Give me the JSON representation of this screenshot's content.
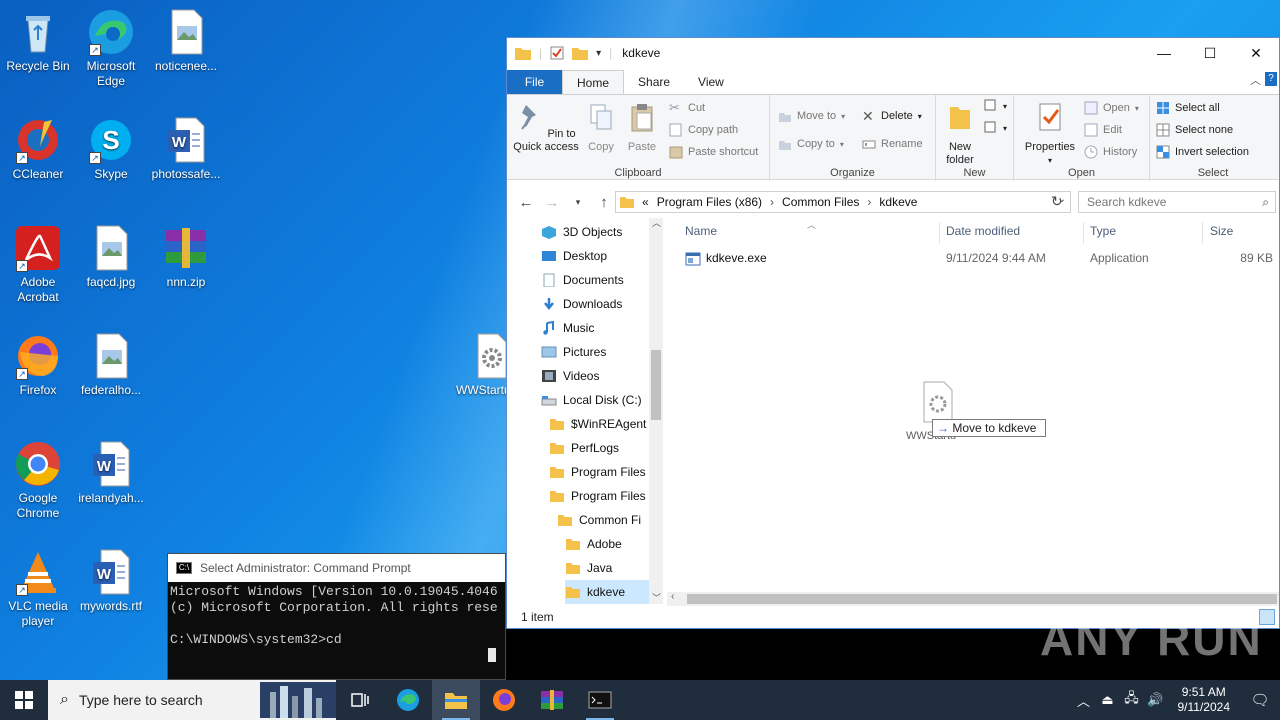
{
  "desktop": {
    "icons": [
      {
        "label": "Recycle Bin",
        "icon": "recycle-bin-icon"
      },
      {
        "label": "Microsoft Edge",
        "icon": "edge-icon"
      },
      {
        "label": "noticenee...",
        "icon": "image-file-icon"
      },
      {
        "label": "CCleaner",
        "icon": "ccleaner-icon"
      },
      {
        "label": "Skype",
        "icon": "skype-icon"
      },
      {
        "label": "photossafe...",
        "icon": "word-doc-icon"
      },
      {
        "label": "Adobe Acrobat",
        "icon": "acrobat-icon"
      },
      {
        "label": "faqcd.jpg",
        "icon": "image-file-icon"
      },
      {
        "label": "nnn.zip",
        "icon": "winrar-icon"
      },
      {
        "label": "Firefox",
        "icon": "firefox-icon"
      },
      {
        "label": "federalho...",
        "icon": "image-file-icon"
      },
      {
        "label": "WWStartu",
        "icon": "gear-file-icon"
      },
      {
        "label": "Google Chrome",
        "icon": "chrome-icon"
      },
      {
        "label": "irelandyah...",
        "icon": "word-doc-icon"
      },
      {
        "label": "VLC media player",
        "icon": "vlc-icon"
      },
      {
        "label": "mywords.rtf",
        "icon": "word-doc-icon"
      }
    ]
  },
  "explorer": {
    "title": "kdkeve",
    "tabs": {
      "file": "File",
      "home": "Home",
      "share": "Share",
      "view": "View"
    },
    "ribbon": {
      "clipboard": {
        "label": "Clipboard",
        "pin": "Pin to Quick access",
        "copy": "Copy",
        "paste": "Paste",
        "cut": "Cut",
        "copy_path": "Copy path",
        "paste_shortcut": "Paste shortcut"
      },
      "organize": {
        "label": "Organize",
        "move_to": "Move to",
        "copy_to": "Copy to",
        "delete": "Delete",
        "rename": "Rename"
      },
      "new": {
        "label": "New",
        "new_folder": "New folder"
      },
      "open": {
        "label": "Open",
        "properties": "Properties",
        "open": "Open",
        "edit": "Edit",
        "history": "History"
      },
      "select": {
        "label": "Select",
        "select_all": "Select all",
        "select_none": "Select none",
        "invert": "Invert selection"
      }
    },
    "address": {
      "prefix": "«",
      "parts": [
        "Program Files (x86)",
        "Common Files",
        "kdkeve"
      ]
    },
    "search_placeholder": "Search kdkeve",
    "nav": [
      {
        "label": "3D Objects",
        "indent": 0
      },
      {
        "label": "Desktop",
        "indent": 0
      },
      {
        "label": "Documents",
        "indent": 0
      },
      {
        "label": "Downloads",
        "indent": 0
      },
      {
        "label": "Music",
        "indent": 0
      },
      {
        "label": "Pictures",
        "indent": 0
      },
      {
        "label": "Videos",
        "indent": 0
      },
      {
        "label": "Local Disk (C:)",
        "indent": 0
      },
      {
        "label": "$WinREAgent",
        "indent": 1
      },
      {
        "label": "PerfLogs",
        "indent": 1
      },
      {
        "label": "Program Files",
        "indent": 1
      },
      {
        "label": "Program Files",
        "indent": 1
      },
      {
        "label": "Common Fi",
        "indent": 2
      },
      {
        "label": "Adobe",
        "indent": 3
      },
      {
        "label": "Java",
        "indent": 3
      },
      {
        "label": "kdkeve",
        "indent": 3
      }
    ],
    "columns": {
      "name": "Name",
      "date": "Date modified",
      "type": "Type",
      "size": "Size"
    },
    "files": [
      {
        "name": "kdkeve.exe",
        "date": "9/11/2024 9:44 AM",
        "type": "Application",
        "size": "89 KB"
      }
    ],
    "status": "1 item",
    "drag": {
      "tooltip_arrow": "→",
      "tooltip": "Move to kdkeve",
      "ghost_name": "WWStartu"
    }
  },
  "cmd": {
    "title": "Select Administrator: Command Prompt",
    "lines": [
      "Microsoft Windows [Version 10.0.19045.4046",
      "(c) Microsoft Corporation. All rights rese",
      "",
      "C:\\WINDOWS\\system32>cd"
    ]
  },
  "taskbar": {
    "search_placeholder": "Type here to search",
    "time": "9:51 AM",
    "date": "9/11/2024"
  },
  "watermark": "ANY RUN"
}
